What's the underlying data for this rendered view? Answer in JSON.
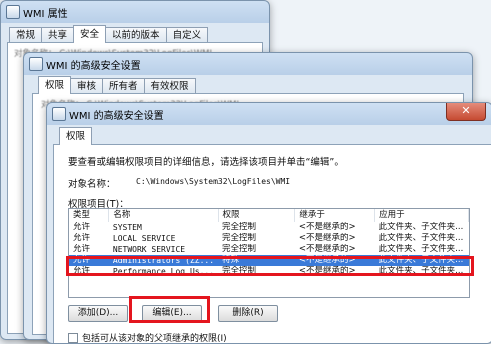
{
  "window1": {
    "title": "WMI 属性",
    "tabs": [
      "常规",
      "共享",
      "安全",
      "以前的版本",
      "自定义"
    ],
    "active_tab": 2,
    "obscured_text": "对象名称：   C:\\Windows\\System32\\LogFiles\\WMI"
  },
  "window2": {
    "title": "WMI 的高级安全设置",
    "tabs": [
      "权限",
      "审核",
      "所有者",
      "有效权限"
    ],
    "obscured_text": "对象名称：   C:\\Windows\\System32\\LogFiles\\WMI"
  },
  "window3": {
    "title": "WMI 的高级安全设置",
    "close_label": "✕",
    "tabs": [
      "权限"
    ],
    "description": "要查看或编辑权限项目的详细信息，请选择该项目并单击“编辑”。",
    "object_label": "对象名称：",
    "object_path": "C:\\Windows\\System32\\LogFiles\\WMI",
    "entries_label": "权限项目(T)：",
    "columns": [
      "类型",
      "名称",
      "权限",
      "继承于",
      "应用于"
    ],
    "rows": [
      [
        "允许",
        "SYSTEM",
        "完全控制",
        "<不是继承的>",
        "此文件夹、子文件夹..."
      ],
      [
        "允许",
        "LOCAL SERVICE",
        "完全控制",
        "<不是继承的>",
        "此文件夹、子文件夹..."
      ],
      [
        "允许",
        "NETWORK SERVICE",
        "完全控制",
        "<不是继承的>",
        "此文件夹、子文件夹..."
      ],
      [
        "允许",
        "Administrators (ZZ...",
        "特殊",
        "<不是继承的>",
        "此文件夹、子文件夹..."
      ],
      [
        "允许",
        "Performance Log Us...",
        "完全控制",
        "<不是继承的>",
        "此文件夹、子文件夹..."
      ]
    ],
    "selected_row": 3,
    "buttons": {
      "add": "添加(D)...",
      "edit": "编辑(E)...",
      "remove": "删除(R)"
    },
    "checkbox_label": "包括可从该对象的父项继承的权限(I)"
  },
  "colors": {
    "highlight": "#e4151e",
    "selection": "#3a7ad8"
  }
}
